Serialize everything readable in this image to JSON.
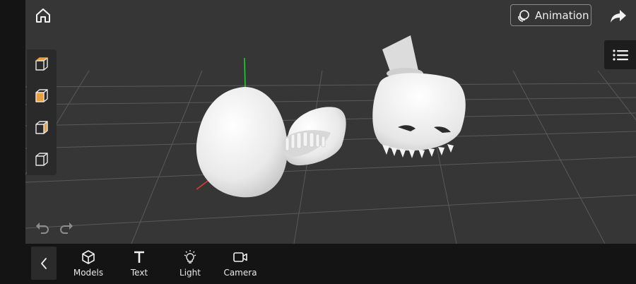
{
  "header": {
    "home_icon": "home-icon",
    "animation_label": "Animation",
    "animation_icon": "animation-layers-icon",
    "share_icon": "share-arrow-icon",
    "menu_icon": "list-menu-icon"
  },
  "view_cubes": [
    {
      "icon": "cube-view-front-icon",
      "highlight": "top"
    },
    {
      "icon": "cube-view-side-icon",
      "highlight": "left"
    },
    {
      "icon": "cube-view-right-icon",
      "highlight": "right"
    },
    {
      "icon": "cube-view-back-icon",
      "highlight": "none"
    }
  ],
  "history": {
    "undo_icon": "undo-icon",
    "redo_icon": "redo-icon"
  },
  "toolbar": {
    "back_icon": "chevron-left-icon",
    "models_label": "Models",
    "text_label": "Text",
    "light_label": "Light",
    "camera_label": "Camera"
  },
  "colors": {
    "viewport_bg": "#363636",
    "panel_bg": "#141414",
    "accent_orange": "#e8a13c",
    "model_white": "#eeeeee",
    "axis_green": "#2ecc40",
    "axis_red": "#e53935"
  }
}
